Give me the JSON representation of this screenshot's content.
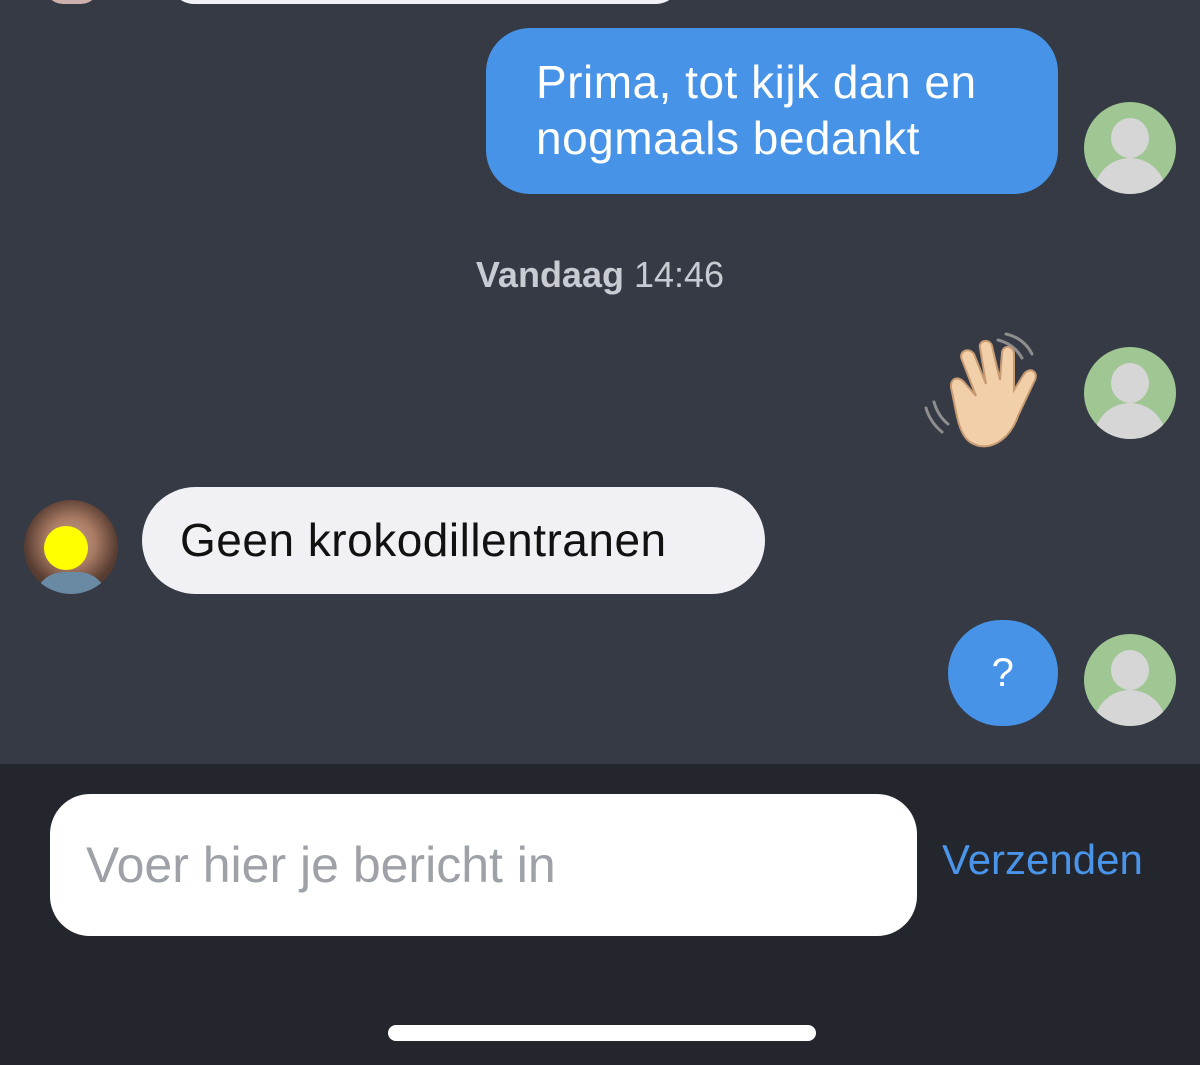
{
  "conversation": {
    "messages": [
      {
        "from": "me",
        "text": "Prima, tot kijk dan en\nnogmaals bedankt"
      },
      {
        "from": "me",
        "emoji": "waving-hand",
        "text": "👋"
      },
      {
        "from": "other",
        "text": "Geen krokodillentranen"
      },
      {
        "from": "me",
        "text": "?"
      }
    ],
    "timestamp": {
      "day": "Vandaag",
      "time": "14:46"
    }
  },
  "composer": {
    "placeholder": "Voer hier je bericht in",
    "send_label": "Verzenden"
  },
  "colors": {
    "chat_background": "#353a44",
    "outgoing_bubble": "#4793e8",
    "incoming_bubble": "#f1f1f5",
    "send_label": "#4a94ea",
    "composer_background": "#23262c"
  }
}
